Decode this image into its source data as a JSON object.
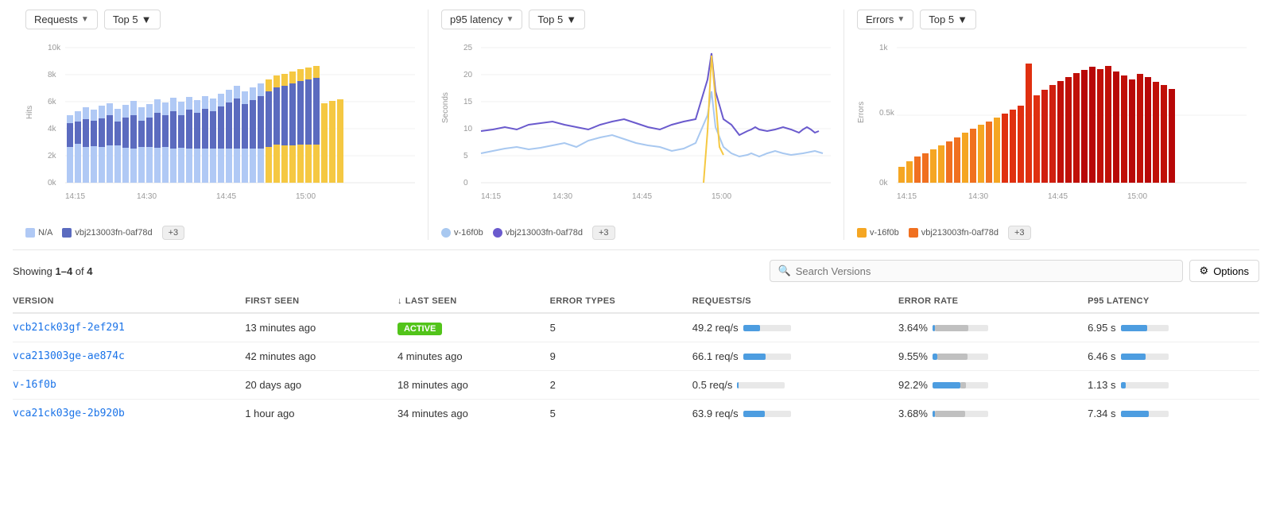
{
  "charts": [
    {
      "id": "requests",
      "title": "Requests",
      "top_label": "Top 5",
      "y_axis_label": "Hits",
      "y_ticks": [
        "10k",
        "8k",
        "6k",
        "4k",
        "2k",
        "0k"
      ],
      "x_ticks": [
        "14:15",
        "14:30",
        "14:45",
        "15:00"
      ],
      "legend": [
        {
          "label": "N/A",
          "color": "#b0c9f5"
        },
        {
          "label": "vbj213003fn-0af78d",
          "color": "#5b6bbf"
        }
      ],
      "more_label": "+3",
      "type": "bar"
    },
    {
      "id": "p95_latency",
      "title": "p95 latency",
      "top_label": "Top 5",
      "y_axis_label": "Seconds",
      "y_ticks": [
        "25",
        "20",
        "15",
        "10",
        "5",
        "0"
      ],
      "x_ticks": [
        "14:15",
        "14:30",
        "14:45",
        "15:00"
      ],
      "legend": [
        {
          "label": "v-16f0b",
          "color": "#a8c8f0"
        },
        {
          "label": "vbj213003fn-0af78d",
          "color": "#6a5acd"
        }
      ],
      "more_label": "+3",
      "type": "line"
    },
    {
      "id": "errors",
      "title": "Errors",
      "top_label": "Top 5",
      "y_axis_label": "Errors",
      "y_ticks": [
        "1k",
        "0.5k",
        "0k"
      ],
      "x_ticks": [
        "14:15",
        "14:30",
        "14:45",
        "15:00"
      ],
      "legend": [
        {
          "label": "v-16f0b",
          "color": "#f5a623"
        },
        {
          "label": "vbj213003fn-0af78d",
          "color": "#f07020"
        }
      ],
      "more_label": "+3",
      "type": "bar"
    }
  ],
  "table": {
    "showing_text": "Showing ",
    "showing_range": "1–4",
    "showing_of": " of ",
    "showing_total": "4",
    "search_placeholder": "Search Versions",
    "options_label": "Options",
    "columns": [
      {
        "key": "version",
        "label": "VERSION"
      },
      {
        "key": "first_seen",
        "label": "FIRST SEEN"
      },
      {
        "key": "last_seen",
        "label": "LAST SEEN",
        "sort": true
      },
      {
        "key": "error_types",
        "label": "ERROR TYPES"
      },
      {
        "key": "requests_s",
        "label": "REQUESTS/S"
      },
      {
        "key": "error_rate",
        "label": "ERROR RATE"
      },
      {
        "key": "p95_latency",
        "label": "P95 LATENCY"
      }
    ],
    "rows": [
      {
        "version": "vcb21ck03gf-2ef291",
        "first_seen": "13 minutes ago",
        "last_seen": "ACTIVE",
        "last_seen_active": true,
        "error_types": "5",
        "requests_s": "49.2 req/s",
        "requests_bar": 35,
        "error_rate": "3.64%",
        "error_bar": 4,
        "error_bar_gray": 60,
        "p95_latency": "6.95 s",
        "latency_bar": 55
      },
      {
        "version": "vca213003ge-ae874c",
        "first_seen": "42 minutes ago",
        "last_seen": "4 minutes ago",
        "last_seen_active": false,
        "error_types": "9",
        "requests_s": "66.1 req/s",
        "requests_bar": 48,
        "error_rate": "9.55%",
        "error_bar": 8,
        "error_bar_gray": 55,
        "p95_latency": "6.46 s",
        "latency_bar": 52
      },
      {
        "version": "v-16f0b",
        "first_seen": "20 days ago",
        "last_seen": "18 minutes ago",
        "last_seen_active": false,
        "error_types": "2",
        "requests_s": "0.5 req/s",
        "requests_bar": 3,
        "error_rate": "92.2%",
        "error_bar": 50,
        "error_bar_gray": 10,
        "p95_latency": "1.13 s",
        "latency_bar": 10
      },
      {
        "version": "vca21ck03ge-2b920b",
        "first_seen": "1 hour ago",
        "last_seen": "34 minutes ago",
        "last_seen_active": false,
        "error_types": "5",
        "requests_s": "63.9 req/s",
        "requests_bar": 46,
        "error_rate": "3.68%",
        "error_bar": 4,
        "error_bar_gray": 55,
        "p95_latency": "7.34 s",
        "latency_bar": 59
      }
    ]
  }
}
